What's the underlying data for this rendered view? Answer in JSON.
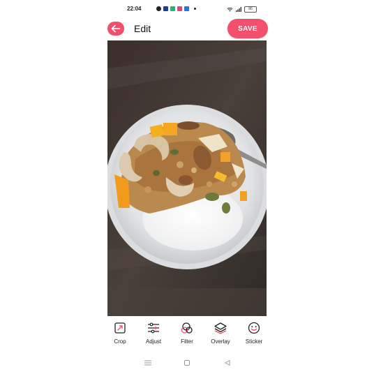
{
  "status_bar": {
    "time": "22:04",
    "battery": "86"
  },
  "header": {
    "title": "Edit",
    "save_label": "SAVE"
  },
  "colors": {
    "accent": "#f2506d",
    "back_button": "#ef4f6b"
  },
  "toolbar": {
    "items": [
      {
        "label": "Crop",
        "icon": "crop-icon"
      },
      {
        "label": "Adjust",
        "icon": "adjust-sliders-icon"
      },
      {
        "label": "Filter",
        "icon": "filter-icon"
      },
      {
        "label": "Overlay",
        "icon": "overlay-layers-icon"
      },
      {
        "label": "Sticker",
        "icon": "sticker-smile-icon"
      }
    ]
  },
  "navigation_bar": {
    "icons": [
      "menu-icon",
      "home-square-icon",
      "back-triangle-icon"
    ]
  }
}
